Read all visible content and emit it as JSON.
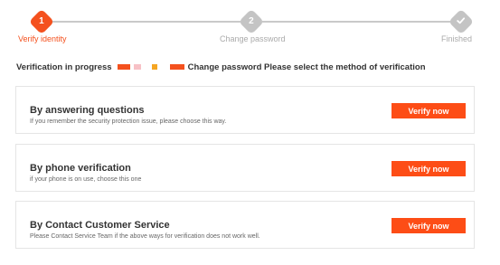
{
  "steps": [
    {
      "number": "1",
      "label": "Verify identity",
      "state": "active"
    },
    {
      "number": "2",
      "label": "Change password",
      "state": "pending"
    },
    {
      "icon": "check-icon",
      "label": "Finished",
      "state": "pending"
    }
  ],
  "progress": {
    "prefix": "Verification in progress",
    "suffix": "Change password Please select the method of verification"
  },
  "methods": [
    {
      "title": "By answering questions",
      "description": "If you remember the security protection issue, please choose this way.",
      "button": "Verify now"
    },
    {
      "title": "By phone verification",
      "description": "if your phone is on use, choose this one",
      "button": "Verify now"
    },
    {
      "title": "By Contact Customer Service",
      "description": "Please Contact Service Team if the above ways for verification does not work well.",
      "button": "Verify now"
    }
  ],
  "colors": {
    "accent": "#fd4d16",
    "inactive": "#c4c4c4"
  }
}
